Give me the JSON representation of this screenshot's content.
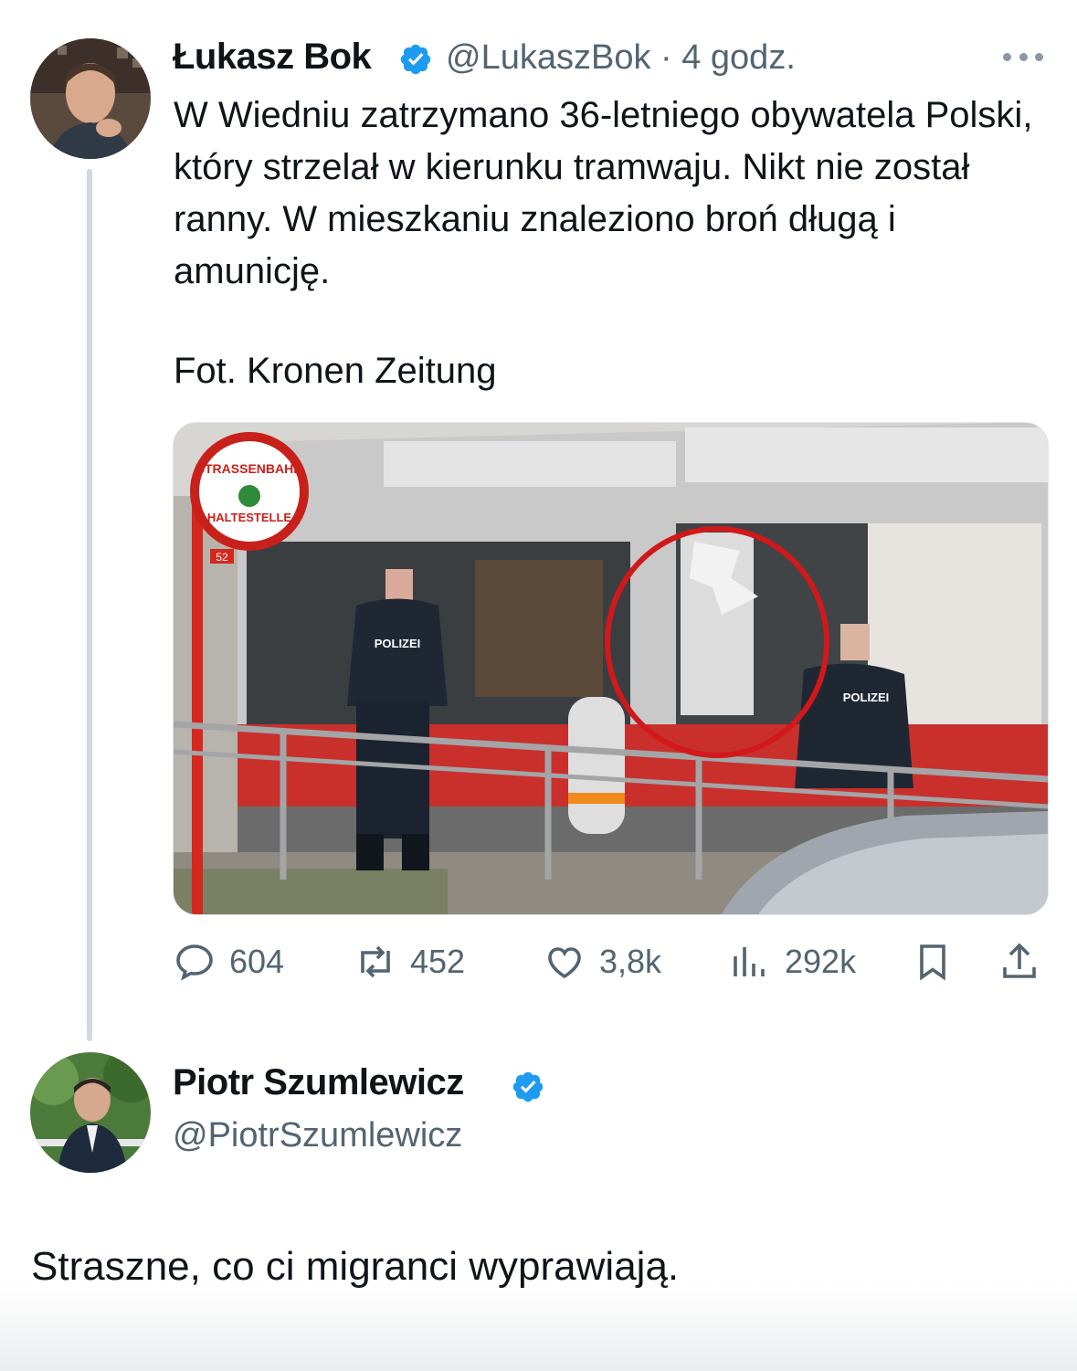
{
  "main_tweet": {
    "author_name": "Łukasz Bok",
    "handle_time": "@LukaszBok · 4 godz.",
    "text": "W Wiedniu zatrzymano 36-letniego obywatela Polski, który strzelał w kierunku tramwaju. Nikt nie został ranny. W mieszkaniu znaleziono broń długą i amunicję.",
    "caption": "Fot. Kronen Zeitung",
    "photo": {
      "stop_sign_top": "STRASSENBAHN",
      "stop_sign_bottom": "HALTESTELLE",
      "stop_number": "52",
      "vest_label": "POLIZEI"
    },
    "stats": {
      "replies": "604",
      "reposts": "452",
      "likes": "3,8k",
      "views": "292k"
    }
  },
  "reply_tweet": {
    "author_name": "Piotr Szumlewicz",
    "handle": "@PiotrSzumlewicz",
    "text": "Straszne, co ci migranci wyprawiają."
  },
  "icons": [
    "more-icon",
    "verified-badge-icon",
    "reply-icon",
    "repost-icon",
    "like-icon",
    "views-icon",
    "bookmark-icon",
    "share-icon"
  ],
  "colors": {
    "verified": "#1d9bf0",
    "secondary_text": "#536471",
    "thread_line": "#cfd9de"
  }
}
